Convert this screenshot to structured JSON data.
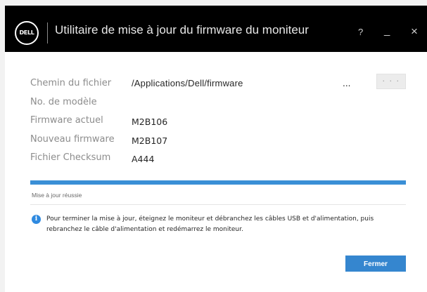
{
  "titlebar": {
    "logo_text": "DELL",
    "title": "Utilitaire de mise à jour du firmware du moniteur",
    "help_label": "?",
    "minimize_label": "_",
    "close_label": "×"
  },
  "form": {
    "file_path_label": "Chemin du fichier",
    "file_path_value": "/Applications/Dell/firmware",
    "path_ellipsis": "...",
    "browse_label": "· · ·",
    "model_label": "No. de modèle",
    "model_value": "",
    "current_fw_label": "Firmware actuel",
    "current_fw_value": "M2B106",
    "new_fw_label": "Nouveau firmware",
    "new_fw_value": "M2B107",
    "checksum_label": "Fichier Checksum",
    "checksum_value": "A444"
  },
  "progress": {
    "percent": 100,
    "status": "Mise à jour réussie"
  },
  "info": {
    "icon": "info-icon",
    "message": "Pour terminer la mise à jour, éteignez le moniteur et débranchez les câbles USB et d'alimentation, puis rebranchez le câble d'alimentation et redémarrez le moniteur."
  },
  "actions": {
    "close_label": "Fermer"
  },
  "colors": {
    "titlebar_bg": "#000000",
    "accent": "#3a8fd6",
    "button_bg": "#3586cf"
  }
}
